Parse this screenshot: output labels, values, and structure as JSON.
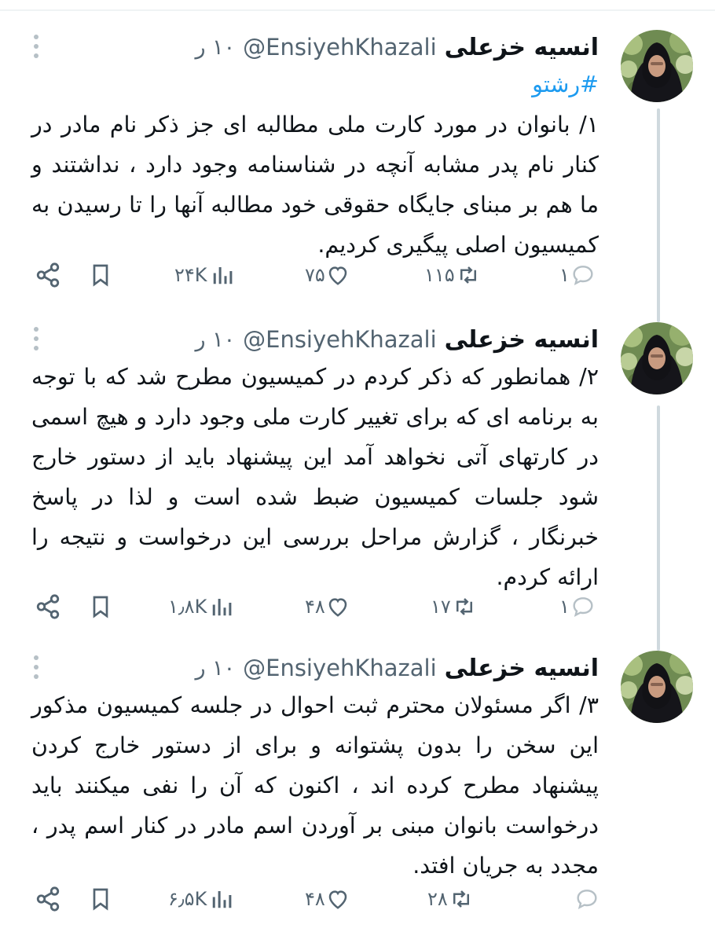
{
  "tweets": [
    {
      "name": "انسیه خزعلی",
      "handle": "@EnsiyehKhazali",
      "time": "۱۰ ر",
      "hashtag": "#رشتو",
      "text": "۱/ بانوان در مورد کارت ملی مطالبه ای جز ذکر نام مادر در کنار نام پدر مشابه آنچه در شناسنامه وجود دارد ، نداشتند و ما هم بر مبنای جایگاه حقوقی خود مطالبه آنها را تا رسیدن به کمیسیون اصلی پیگیری کردیم.",
      "replies": "۱",
      "retweets": "۱۱۵",
      "likes": "۷۵",
      "views": "۲۴K"
    },
    {
      "name": "انسیه خزعلی",
      "handle": "@EnsiyehKhazali",
      "time": "۱۰ ر",
      "hashtag": "",
      "text": "۲/ همانطور که ذکر کردم در کمیسیون مطرح شد که با توجه به برنامه ای که برای تغییر کارت ملی وجود دارد و هیچ اسمی در کارتهای آتی نخواهد آمد این پیشنهاد باید از دستور خارج شود جلسات کمیسیون ضبط شده است و لذا در پاسخ خبرنگار ، گزارش مراحل بررسی این درخواست و نتیجه را ارائه کردم.",
      "replies": "۱",
      "retweets": "۱۷",
      "likes": "۴۸",
      "views": "۱٫۸K"
    },
    {
      "name": "انسیه خزعلی",
      "handle": "@EnsiyehKhazali",
      "time": "۱۰ ر",
      "hashtag": "",
      "text": "۳/ اگر مسئولان محترم ثبت احوال در جلسه کمیسیون مذکور این سخن را بدون پشتوانه و برای از دستور خارج کردن پیشنهاد مطرح کرده اند ، اکنون که آن را نفی میکنند باید درخواست بانوان مبنی بر آوردن اسم مادر در کنار اسم پدر ، مجدد به جریان افتد.",
      "replies": "",
      "retweets": "۲۸",
      "likes": "۴۸",
      "views": "۶٫۵K"
    }
  ],
  "icons": {
    "reply": "reply-icon",
    "retweet": "retweet-icon",
    "like": "heart-icon",
    "views": "views-icon",
    "bookmark": "bookmark-icon",
    "share": "share-icon",
    "more": "more-icon"
  },
  "colors": {
    "text": "#0f1419",
    "secondary": "#536471",
    "link": "#1d9bf0",
    "thread_line": "#cfd9de"
  }
}
